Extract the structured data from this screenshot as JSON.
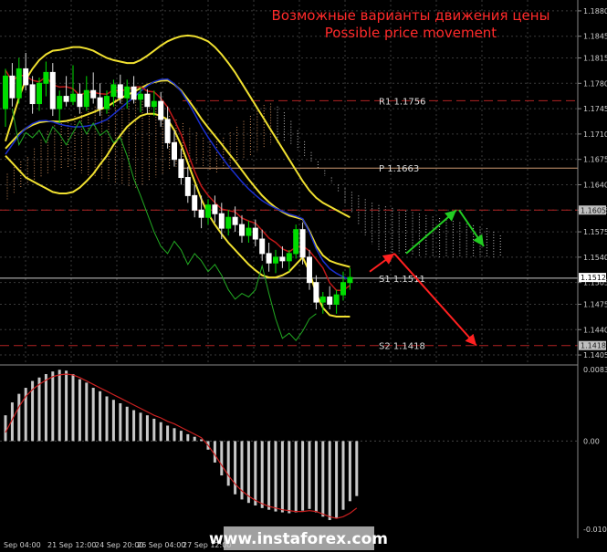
{
  "chart_data": {
    "type": "candlestick",
    "title": "Возможные варианты движения цены",
    "subtitle": "Possible price movement",
    "price_axis": {
      "ylim": [
        1.1395,
        1.1895
      ],
      "ticks": [
        "1.1880",
        "1.1845",
        "1.1815",
        "1.1780",
        "1.1745",
        "1.1710",
        "1.1675",
        "1.1640",
        "1.1605",
        "1.1575",
        "1.1540",
        "1.1505",
        "1.1475",
        "1.1440",
        "1.1405"
      ]
    },
    "time_axis": {
      "ticks": [
        "Sep 04:00",
        "21 Sep 12:00",
        "24 Sep 20:00",
        "26 Sep 04:00",
        "27 Sep 12:00"
      ]
    },
    "levels": [
      {
        "label": "R1  1.1756",
        "value": 1.1756,
        "color": "#b22222",
        "style": "dashed"
      },
      {
        "label": "P  1.1663",
        "value": 1.1663,
        "color": "#cd9b73",
        "style": "solid"
      },
      {
        "label": "1.1605",
        "value": 1.1605,
        "color": "#b22222",
        "style": "dashed"
      },
      {
        "label": "S1  1.1511",
        "value": 1.1511,
        "color": "#cccccc",
        "style": "solid"
      },
      {
        "label": "S2  1.1418",
        "value": 1.1418,
        "color": "#b22222",
        "style": "dashed"
      }
    ],
    "current_price": "1.1512",
    "candles": [
      [
        1.1745,
        1.18,
        1.172,
        1.179
      ],
      [
        1.179,
        1.1808,
        1.1748,
        1.176
      ],
      [
        1.176,
        1.1815,
        1.1752,
        1.18
      ],
      [
        1.18,
        1.1822,
        1.177,
        1.1778
      ],
      [
        1.1778,
        1.179,
        1.1738,
        1.1752
      ],
      [
        1.1752,
        1.1788,
        1.1742,
        1.178
      ],
      [
        1.178,
        1.181,
        1.1762,
        1.1795
      ],
      [
        1.1795,
        1.1808,
        1.1735,
        1.1745
      ],
      [
        1.1745,
        1.177,
        1.1725,
        1.1762
      ],
      [
        1.1762,
        1.179,
        1.1748,
        1.1755
      ],
      [
        1.1755,
        1.1805,
        1.175,
        1.1765
      ],
      [
        1.1765,
        1.178,
        1.1738,
        1.1748
      ],
      [
        1.1748,
        1.179,
        1.1742,
        1.177
      ],
      [
        1.177,
        1.1795,
        1.1752,
        1.176
      ],
      [
        1.176,
        1.178,
        1.1735,
        1.1745
      ],
      [
        1.1745,
        1.177,
        1.1738,
        1.1762
      ],
      [
        1.1762,
        1.1785,
        1.1748,
        1.1778
      ],
      [
        1.1778,
        1.1792,
        1.1752,
        1.176
      ],
      [
        1.176,
        1.1785,
        1.1745,
        1.1775
      ],
      [
        1.1775,
        1.179,
        1.1752,
        1.1758
      ],
      [
        1.1758,
        1.1775,
        1.174,
        1.1765
      ],
      [
        1.1765,
        1.1772,
        1.1738,
        1.1748
      ],
      [
        1.1748,
        1.177,
        1.1735,
        1.1755
      ],
      [
        1.1755,
        1.1768,
        1.172,
        1.173
      ],
      [
        1.173,
        1.1748,
        1.169,
        1.1698
      ],
      [
        1.1698,
        1.1715,
        1.1665,
        1.1675
      ],
      [
        1.1675,
        1.169,
        1.164,
        1.165
      ],
      [
        1.165,
        1.1665,
        1.1615,
        1.1625
      ],
      [
        1.1625,
        1.164,
        1.1595,
        1.1605
      ],
      [
        1.1605,
        1.1625,
        1.158,
        1.1595
      ],
      [
        1.1595,
        1.162,
        1.1585,
        1.1612
      ],
      [
        1.1612,
        1.1625,
        1.1588,
        1.16
      ],
      [
        1.16,
        1.1615,
        1.1565,
        1.158
      ],
      [
        1.158,
        1.1605,
        1.157,
        1.1595
      ],
      [
        1.1595,
        1.161,
        1.1575,
        1.1585
      ],
      [
        1.1585,
        1.1598,
        1.156,
        1.157
      ],
      [
        1.157,
        1.159,
        1.156,
        1.158
      ],
      [
        1.158,
        1.1592,
        1.1555,
        1.1565
      ],
      [
        1.1565,
        1.1578,
        1.1535,
        1.1545
      ],
      [
        1.1545,
        1.156,
        1.152,
        1.1532
      ],
      [
        1.1532,
        1.155,
        1.1518,
        1.154
      ],
      [
        1.154,
        1.1555,
        1.1525,
        1.1535
      ],
      [
        1.1535,
        1.155,
        1.152,
        1.1545
      ],
      [
        1.1545,
        1.1585,
        1.1538,
        1.1578
      ],
      [
        1.1578,
        1.1588,
        1.153,
        1.154
      ],
      [
        1.154,
        1.155,
        1.1495,
        1.1505
      ],
      [
        1.1505,
        1.1515,
        1.1468,
        1.1478
      ],
      [
        1.1478,
        1.1492,
        1.1462,
        1.1485
      ],
      [
        1.1485,
        1.15,
        1.1468,
        1.1475
      ],
      [
        1.1475,
        1.1495,
        1.1462,
        1.1488
      ],
      [
        1.1488,
        1.152,
        1.148,
        1.1505
      ],
      [
        1.1505,
        1.1525,
        1.1495,
        1.1512
      ]
    ],
    "arrows": [
      {
        "color": "#ff2020",
        "points": [
          [
            1.152
          ],
          [
            1.1545
          ]
        ]
      },
      {
        "color": "#22cc22",
        "points": [
          [
            1.1545
          ],
          [
            1.1605
          ]
        ]
      },
      {
        "color": "#22cc22",
        "points": [
          [
            1.1605
          ],
          [
            1.1555
          ]
        ]
      },
      {
        "color": "#ff2020",
        "points": [
          [
            1.1545
          ],
          [
            1.1418
          ]
        ]
      }
    ],
    "oscillator": {
      "ylim": [
        -0.01026,
        0.00833
      ],
      "ticks": [
        "0.00833",
        "0.00",
        "-0.01026"
      ],
      "histogram": [
        0.003,
        0.0045,
        0.0055,
        0.0062,
        0.007,
        0.0074,
        0.0078,
        0.0081,
        0.0083,
        0.0082,
        0.0078,
        0.0072,
        0.0068,
        0.0062,
        0.0058,
        0.0052,
        0.0048,
        0.0044,
        0.004,
        0.0036,
        0.0033,
        0.003,
        0.0026,
        0.0022,
        0.0018,
        0.0015,
        0.0012,
        0.0008,
        0.0005,
        0.0002,
        -0.001,
        -0.0025,
        -0.004,
        -0.0052,
        -0.0062,
        -0.0068,
        -0.0072,
        -0.0075,
        -0.0078,
        -0.008,
        -0.0082,
        -0.0083,
        -0.0084,
        -0.0083,
        -0.0081,
        -0.0079,
        -0.0083,
        -0.0088,
        -0.0092,
        -0.009,
        -0.008,
        -0.007,
        -0.0064
      ],
      "signal": [
        0.001,
        0.0025,
        0.004,
        0.0052,
        0.006,
        0.0066,
        0.0071,
        0.0075,
        0.0077,
        0.0078,
        0.0077,
        0.0074,
        0.007,
        0.0066,
        0.0062,
        0.0058,
        0.0054,
        0.005,
        0.0046,
        0.0042,
        0.0038,
        0.0034,
        0.003,
        0.0027,
        0.0023,
        0.002,
        0.0016,
        0.0012,
        0.0008,
        0.0004,
        -0.0005,
        -0.0016,
        -0.0028,
        -0.004,
        -0.005,
        -0.0058,
        -0.0064,
        -0.0069,
        -0.0073,
        -0.0076,
        -0.0078,
        -0.008,
        -0.0081,
        -0.0082,
        -0.0082,
        -0.0081,
        -0.0082,
        -0.0085,
        -0.0088,
        -0.009,
        -0.0088,
        -0.0084,
        -0.0078
      ]
    },
    "watermark": "www.instaforex.com"
  }
}
